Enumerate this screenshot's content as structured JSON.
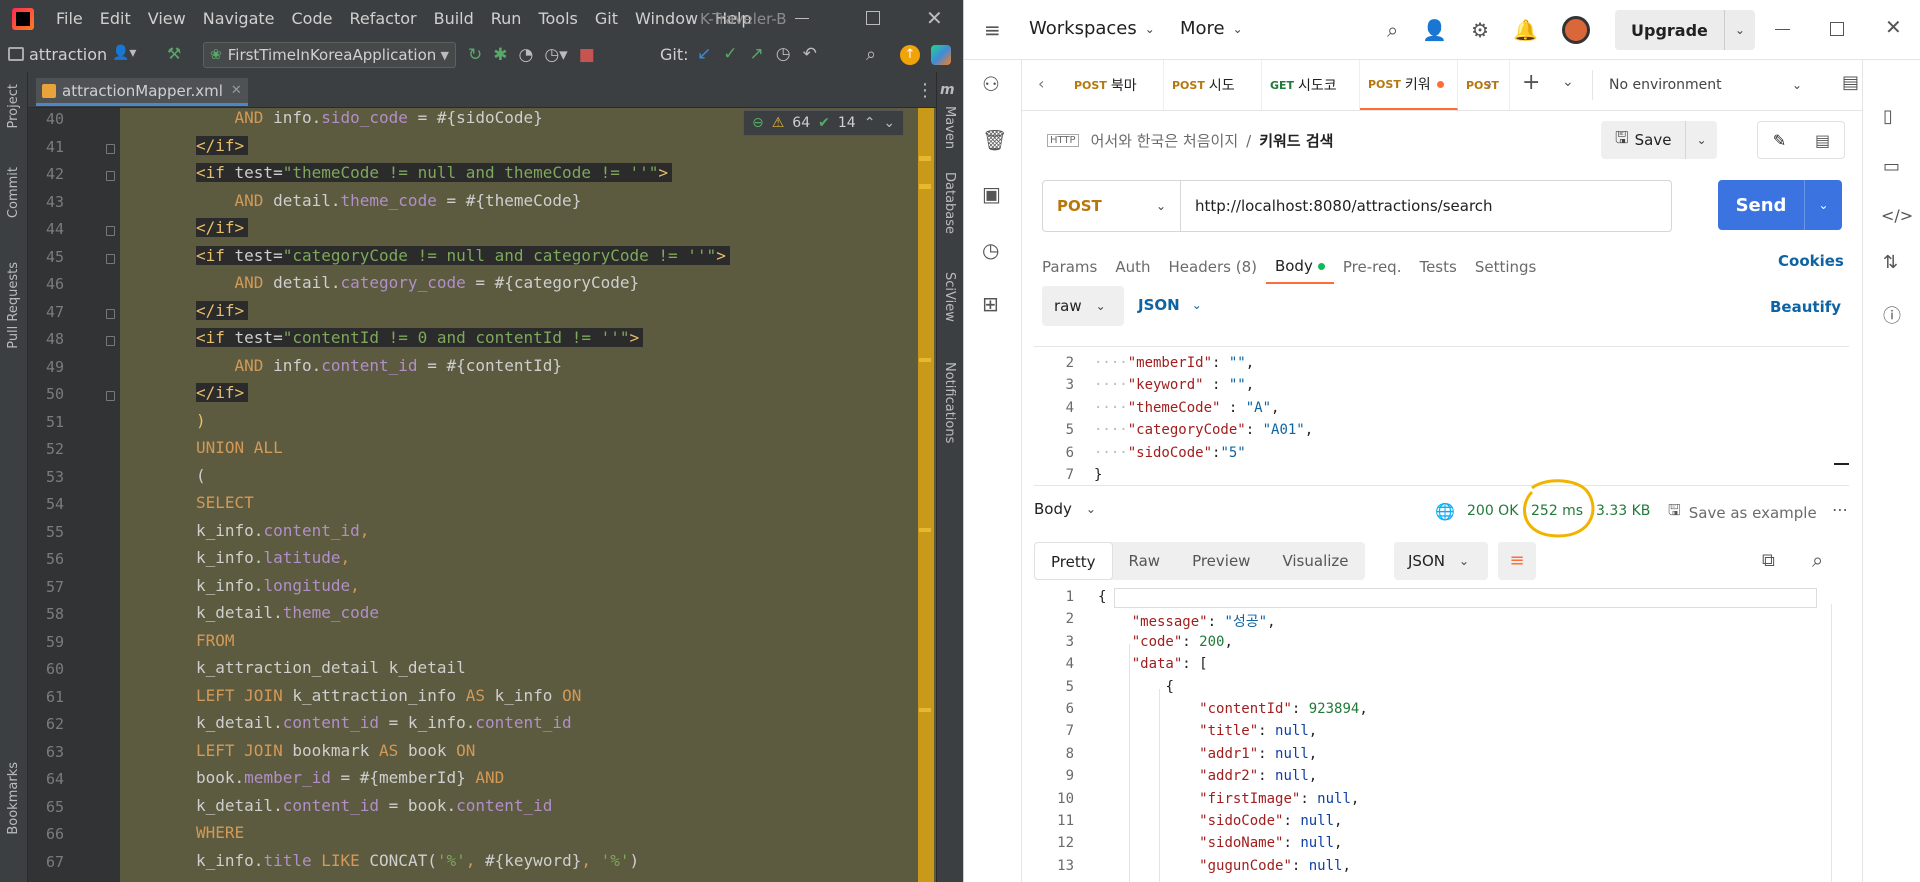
{
  "ide": {
    "menu": [
      "File",
      "Edit",
      "View",
      "Navigate",
      "Code",
      "Refactor",
      "Build",
      "Run",
      "Tools",
      "Git",
      "Window",
      "Help"
    ],
    "window_title": "K-Traveler-B",
    "project_label": "attraction",
    "run_config": "FirstTimeInKoreaApplication",
    "git_label": "Git:",
    "file_tab": "attractionMapper.xml",
    "warnings": "64",
    "checks": "14",
    "left_tools": [
      "Project",
      "Commit",
      "Pull Requests",
      "Bookmarks"
    ],
    "right_tools": [
      "Maven",
      "Database",
      "SciView",
      "Notifications"
    ],
    "line_numbers": [
      "40",
      "41",
      "42",
      "43",
      "44",
      "45",
      "46",
      "47",
      "48",
      "49",
      "50",
      "51",
      "52",
      "53",
      "54",
      "55",
      "56",
      "57",
      "58",
      "59",
      "60",
      "61",
      "62",
      "63",
      "64",
      "65",
      "66",
      "67"
    ],
    "code_lines": [
      {
        "indent": "    ",
        "parts": [
          [
            "kw",
            "AND "
          ],
          [
            "pl",
            "info."
          ],
          [
            "fd",
            "sido_code"
          ],
          [
            "pl",
            " = #{sidoCode}"
          ]
        ]
      },
      {
        "indent": "",
        "parts": [
          [
            "tg",
            "</if>"
          ]
        ]
      },
      {
        "indent": "",
        "parts": [
          [
            "tg",
            "<if "
          ],
          [
            "pl",
            "test="
          ],
          [
            "st",
            "\"themeCode != null and themeCode != ''\""
          ],
          [
            "tg",
            ">"
          ]
        ]
      },
      {
        "indent": "    ",
        "parts": [
          [
            "kw",
            "AND "
          ],
          [
            "pl",
            "detail."
          ],
          [
            "fd",
            "theme_code"
          ],
          [
            "pl",
            " = #{themeCode}"
          ]
        ]
      },
      {
        "indent": "",
        "parts": [
          [
            "tg",
            "</if>"
          ]
        ]
      },
      {
        "indent": "",
        "parts": [
          [
            "tg",
            "<if "
          ],
          [
            "pl",
            "test="
          ],
          [
            "st",
            "\"categoryCode != null and categoryCode != ''\""
          ],
          [
            "tg",
            ">"
          ]
        ]
      },
      {
        "indent": "    ",
        "parts": [
          [
            "kw",
            "AND "
          ],
          [
            "pl",
            "detail."
          ],
          [
            "fd",
            "category_code"
          ],
          [
            "pl",
            " = #{categoryCode}"
          ]
        ]
      },
      {
        "indent": "",
        "parts": [
          [
            "tg",
            "</if>"
          ]
        ]
      },
      {
        "indent": "",
        "parts": [
          [
            "tg",
            "<if "
          ],
          [
            "pl",
            "test="
          ],
          [
            "st",
            "\"contentId != 0 and contentId != ''\""
          ],
          [
            "tg",
            ">"
          ]
        ]
      },
      {
        "indent": "    ",
        "parts": [
          [
            "kw",
            "AND "
          ],
          [
            "pl",
            "info."
          ],
          [
            "fd",
            "content_id"
          ],
          [
            "pl",
            " = #{contentId}"
          ]
        ]
      },
      {
        "indent": "",
        "parts": [
          [
            "tg",
            "</if>"
          ]
        ]
      },
      {
        "indent": "",
        "parts": [
          [
            "tg",
            ")"
          ]
        ]
      },
      {
        "indent": "",
        "parts": [
          [
            "kw",
            "UNION ALL"
          ]
        ]
      },
      {
        "indent": "",
        "parts": [
          [
            "pl",
            "("
          ]
        ]
      },
      {
        "indent": "",
        "parts": [
          [
            "kw",
            "SELECT"
          ]
        ]
      },
      {
        "indent": "",
        "parts": [
          [
            "pl",
            "k_info."
          ],
          [
            "fd",
            "content_id"
          ],
          [
            "kw",
            ","
          ]
        ]
      },
      {
        "indent": "",
        "parts": [
          [
            "pl",
            "k_info."
          ],
          [
            "fd",
            "latitude"
          ],
          [
            "kw",
            ","
          ]
        ]
      },
      {
        "indent": "",
        "parts": [
          [
            "pl",
            "k_info."
          ],
          [
            "fd",
            "longitude"
          ],
          [
            "kw",
            ","
          ]
        ]
      },
      {
        "indent": "",
        "parts": [
          [
            "pl",
            "k_detail."
          ],
          [
            "fd",
            "theme_code"
          ]
        ]
      },
      {
        "indent": "",
        "parts": [
          [
            "kw",
            "FROM"
          ]
        ]
      },
      {
        "indent": "",
        "parts": [
          [
            "pl",
            "k_attraction_detail k_detail"
          ]
        ]
      },
      {
        "indent": "",
        "parts": [
          [
            "kw",
            "LEFT JOIN "
          ],
          [
            "pl",
            "k_attraction_info "
          ],
          [
            "kw",
            "AS "
          ],
          [
            "pl",
            "k_info "
          ],
          [
            "kw",
            "ON"
          ]
        ]
      },
      {
        "indent": "",
        "parts": [
          [
            "pl",
            "k_detail."
          ],
          [
            "fd",
            "content_id"
          ],
          [
            "pl",
            " = k_info."
          ],
          [
            "fd",
            "content_id"
          ]
        ]
      },
      {
        "indent": "",
        "parts": [
          [
            "kw",
            "LEFT JOIN "
          ],
          [
            "pl",
            "bookmark "
          ],
          [
            "kw",
            "AS "
          ],
          [
            "pl",
            "book "
          ],
          [
            "kw",
            "ON"
          ]
        ]
      },
      {
        "indent": "",
        "parts": [
          [
            "pl",
            "book."
          ],
          [
            "fd",
            "member_id"
          ],
          [
            "pl",
            " = #{memberId} "
          ],
          [
            "kw",
            "AND"
          ]
        ]
      },
      {
        "indent": "",
        "parts": [
          [
            "pl",
            "k_detail."
          ],
          [
            "fd",
            "content_id"
          ],
          [
            "pl",
            " = book."
          ],
          [
            "fd",
            "content_id"
          ]
        ]
      },
      {
        "indent": "",
        "parts": [
          [
            "kw",
            "WHERE"
          ]
        ]
      },
      {
        "indent": "",
        "parts": [
          [
            "pl",
            "k_info."
          ],
          [
            "fd",
            "title"
          ],
          [
            "kw",
            " LIKE "
          ],
          [
            "pl",
            "CONCAT("
          ],
          [
            "st",
            "'%'"
          ],
          [
            "kw",
            ", "
          ],
          [
            "pl",
            "#{keyword}"
          ],
          [
            "kw",
            ", "
          ],
          [
            "st",
            "'%'"
          ],
          [
            "pl",
            ")"
          ]
        ]
      }
    ]
  },
  "postman": {
    "workspaces": "Workspaces",
    "more": "More",
    "upgrade": "Upgrade",
    "tabs": [
      {
        "method": "POST",
        "name": "북마"
      },
      {
        "method": "POST",
        "name": "시도"
      },
      {
        "method": "GET",
        "name": "시도코"
      },
      {
        "method": "POST",
        "name": "키워"
      },
      {
        "method": "POST",
        "name": ""
      }
    ],
    "environment": "No environment",
    "breadcrumb_parent": "어서와 한국은 처음이지",
    "breadcrumb_sep": "/",
    "request_name": "키워드 검색",
    "save": "Save",
    "method": "POST",
    "url": "http://localhost:8080/attractions/search",
    "send": "Send",
    "req_tabs": [
      "Params",
      "Auth",
      "Headers (8)",
      "Body",
      "Pre-req.",
      "Tests",
      "Settings"
    ],
    "cookies": "Cookies",
    "body_mode": "raw",
    "body_lang": "JSON",
    "beautify": "Beautify",
    "req_line_numbers": [
      "2",
      "3",
      "4",
      "5",
      "6",
      "7"
    ],
    "req_lines": [
      [
        [
          "dots",
          "····"
        ],
        [
          "jk",
          "\"memberId\""
        ],
        [
          "jp",
          ": "
        ],
        [
          "js",
          "\"\""
        ],
        [
          "jp",
          ","
        ]
      ],
      [
        [
          "dots",
          "····"
        ],
        [
          "jk",
          "\"keyword\""
        ],
        [
          "jp",
          " : "
        ],
        [
          "js",
          "\"\""
        ],
        [
          "jp",
          ","
        ]
      ],
      [
        [
          "dots",
          "····"
        ],
        [
          "jk",
          "\"themeCode\""
        ],
        [
          "jp",
          " : "
        ],
        [
          "js",
          "\"A\""
        ],
        [
          "jp",
          ","
        ]
      ],
      [
        [
          "dots",
          "····"
        ],
        [
          "jk",
          "\"categoryCode\""
        ],
        [
          "jp",
          ": "
        ],
        [
          "js",
          "\"A01\""
        ],
        [
          "jp",
          ","
        ]
      ],
      [
        [
          "dots",
          "····"
        ],
        [
          "jk",
          "\"sidoCode\""
        ],
        [
          "jp",
          ":"
        ],
        [
          "js",
          "\"5\""
        ]
      ],
      [
        [
          "jp",
          "}"
        ]
      ]
    ],
    "response": {
      "label": "Body",
      "status": "200 OK",
      "time": "252 ms",
      "size": "3.33 KB",
      "save_example": "Save as example",
      "view_tabs": [
        "Pretty",
        "Raw",
        "Preview",
        "Visualize"
      ],
      "format": "JSON",
      "line_numbers": [
        "1",
        "2",
        "3",
        "4",
        "5",
        "6",
        "7",
        "8",
        "9",
        "10",
        "11",
        "12",
        "13"
      ],
      "lines": [
        [
          [
            "jp",
            "{"
          ]
        ],
        [
          [
            "ind",
            "    "
          ],
          [
            "jk",
            "\"message\""
          ],
          [
            "jp",
            ": "
          ],
          [
            "js",
            "\"성공\""
          ],
          [
            "jp",
            ","
          ]
        ],
        [
          [
            "ind",
            "    "
          ],
          [
            "jk",
            "\"code\""
          ],
          [
            "jp",
            ": "
          ],
          [
            "jn",
            "200"
          ],
          [
            "jp",
            ","
          ]
        ],
        [
          [
            "ind",
            "    "
          ],
          [
            "jk",
            "\"data\""
          ],
          [
            "jp",
            ": ["
          ]
        ],
        [
          [
            "ind",
            "        "
          ],
          [
            "jp",
            "{"
          ]
        ],
        [
          [
            "ind",
            "            "
          ],
          [
            "jk",
            "\"contentId\""
          ],
          [
            "jp",
            ": "
          ],
          [
            "jn",
            "923894"
          ],
          [
            "jp",
            ","
          ]
        ],
        [
          [
            "ind",
            "            "
          ],
          [
            "jk",
            "\"title\""
          ],
          [
            "jp",
            ": "
          ],
          [
            "jnull",
            "null"
          ],
          [
            "jp",
            ","
          ]
        ],
        [
          [
            "ind",
            "            "
          ],
          [
            "jk",
            "\"addr1\""
          ],
          [
            "jp",
            ": "
          ],
          [
            "jnull",
            "null"
          ],
          [
            "jp",
            ","
          ]
        ],
        [
          [
            "ind",
            "            "
          ],
          [
            "jk",
            "\"addr2\""
          ],
          [
            "jp",
            ": "
          ],
          [
            "jnull",
            "null"
          ],
          [
            "jp",
            ","
          ]
        ],
        [
          [
            "ind",
            "            "
          ],
          [
            "jk",
            "\"firstImage\""
          ],
          [
            "jp",
            ": "
          ],
          [
            "jnull",
            "null"
          ],
          [
            "jp",
            ","
          ]
        ],
        [
          [
            "ind",
            "            "
          ],
          [
            "jk",
            "\"sidoCode\""
          ],
          [
            "jp",
            ": "
          ],
          [
            "jnull",
            "null"
          ],
          [
            "jp",
            ","
          ]
        ],
        [
          [
            "ind",
            "            "
          ],
          [
            "jk",
            "\"sidoName\""
          ],
          [
            "jp",
            ": "
          ],
          [
            "jnull",
            "null"
          ],
          [
            "jp",
            ","
          ]
        ],
        [
          [
            "ind",
            "            "
          ],
          [
            "jk",
            "\"gugunCode\""
          ],
          [
            "jp",
            ": "
          ],
          [
            "jnull",
            "null"
          ],
          [
            "jp",
            ","
          ]
        ]
      ]
    },
    "colors": {
      "send": "#3b73e0",
      "accent": "#ff6c37",
      "status_ok": "#217a39",
      "annotation": "#f0b400"
    }
  }
}
